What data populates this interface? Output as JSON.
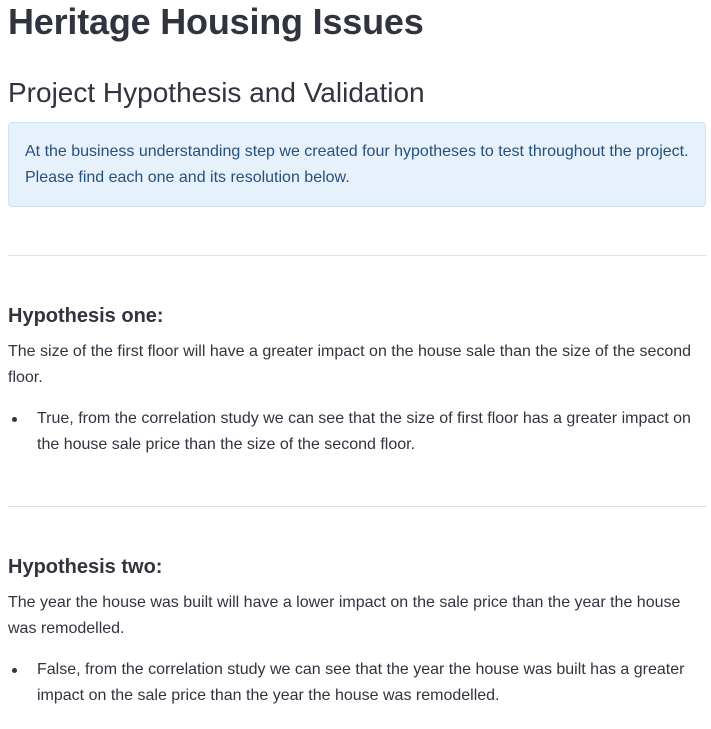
{
  "app": {
    "title": "Heritage Housing Issues"
  },
  "section": {
    "title": "Project Hypothesis and Validation",
    "info": "At the business understanding step we created four hypotheses to test throughout the project. Please find each one and its resolution below."
  },
  "hypotheses": [
    {
      "heading": "Hypothesis one:",
      "statement": "The size of the first floor will have a greater impact on the house sale than the size of the second floor.",
      "resolution": "True, from the correlation study we can see that the size of first floor has a greater impact on the house sale price than the size of the second floor."
    },
    {
      "heading": "Hypothesis two:",
      "statement": "The year the house was built will have a lower impact on the sale price than the year the house was remodelled.",
      "resolution": "False, from the correlation study we can see that the year the house was built has a greater impact on the sale price than the year the house was remodelled."
    }
  ],
  "colors": {
    "text": "#31333f",
    "info_background": "#e6f1fb",
    "info_text": "#25517d",
    "divider": "#dedee3"
  }
}
